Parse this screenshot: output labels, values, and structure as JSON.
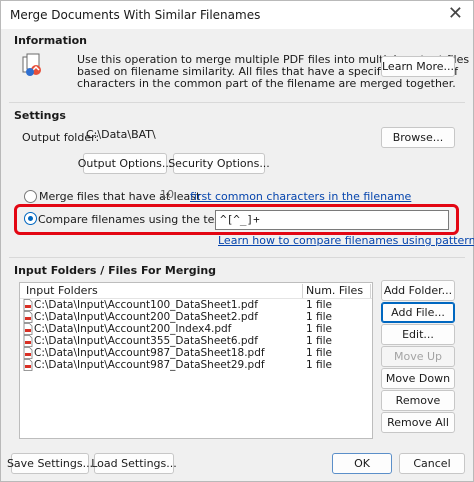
{
  "window": {
    "title": "Merge Documents With Similar Filenames"
  },
  "information": {
    "heading": "Information",
    "description": "Use this operation to merge multiple PDF files into multiple output files based on filename similarity. All files that have a specified number of characters in the common part of the filename are merged together.",
    "lines": [
      "Use this operation to merge multiple PDF files into multiple output files",
      "based on filename similarity. All files that have a specified number of",
      "characters in the common part of the filename are merged together."
    ],
    "learn_more": "Learn More..."
  },
  "settings": {
    "heading": "Settings",
    "output_folder_label": "Output folder:",
    "output_folder_value": "C:\\Data\\BAT\\",
    "browse": "Browse...",
    "output_options": "Output Options...",
    "security_options": "Security Options...",
    "merge_by_count_label": "Merge files that have at least",
    "merge_by_count_value": "10",
    "merge_by_count_link": "first common characters in the filename",
    "merge_by_pattern_label": "Compare filenames using the text pattern:",
    "pattern_value": "^[^_]+",
    "pattern_help_link": "Learn how to compare filenames using patterns..."
  },
  "input": {
    "heading": "Input Folders / Files For Merging",
    "columns": [
      "Input Folders",
      "Num. Files"
    ],
    "rows": [
      {
        "path": "C:\\Data\\Input\\Account100_DataSheet1.pdf",
        "count": "1 file"
      },
      {
        "path": "C:\\Data\\Input\\Account200_DataSheet2.pdf",
        "count": "1 file"
      },
      {
        "path": "C:\\Data\\Input\\Account200_Index4.pdf",
        "count": "1 file"
      },
      {
        "path": "C:\\Data\\Input\\Account355_DataSheet6.pdf",
        "count": "1 file"
      },
      {
        "path": "C:\\Data\\Input\\Account987_DataSheet18.pdf",
        "count": "1 file"
      },
      {
        "path": "C:\\Data\\Input\\Account987_DataSheet29.pdf",
        "count": "1 file"
      }
    ],
    "buttons": {
      "add_folder": "Add Folder...",
      "add_file": "Add File...",
      "edit": "Edit...",
      "move_up": "Move Up",
      "move_down": "Move Down",
      "remove": "Remove",
      "remove_all": "Remove All"
    }
  },
  "footer": {
    "save_settings": "Save Settings...",
    "load_settings": "Load Settings...",
    "ok": "OK",
    "cancel": "Cancel"
  },
  "colors": {
    "highlight": "#e30613",
    "accent": "#0067c0",
    "link": "#0645ad",
    "pdf_icon": "#d93025"
  },
  "icons": {
    "info": "merge-info-icon",
    "file": "pdf-file-icon",
    "close": "close-icon"
  }
}
